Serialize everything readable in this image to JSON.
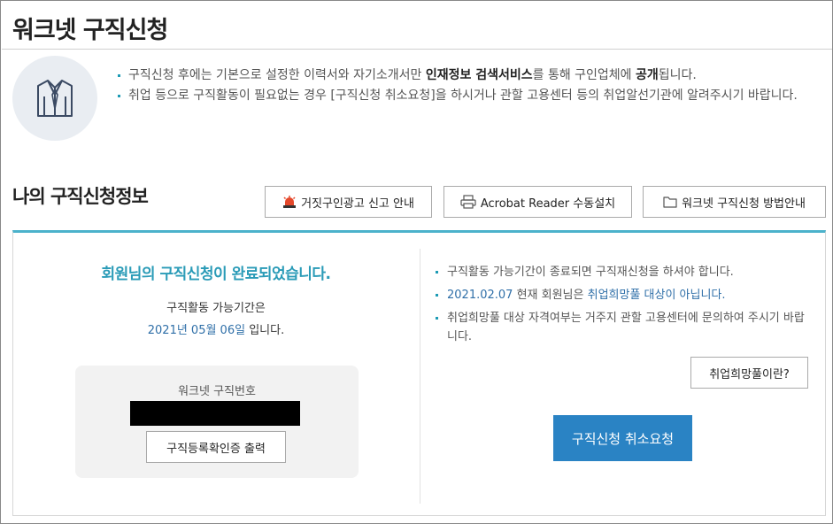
{
  "header": {
    "title": "워크넷 구직신청"
  },
  "intro": {
    "icon": "shirt-icon",
    "line1": {
      "pre": "구직신청 후에는 기본으로 설정한 이력서와 자기소개서만 ",
      "bold1": "인재정보 검색서비스",
      "mid": "를 통해 구인업체에 ",
      "bold2": "공개",
      "post": "됩니다."
    },
    "line2": "취업 등으로 구직활동이 필요없는 경우 [구직신청 취소요청]을 하시거나 관할 고용센터 등의 취업알선기관에 알려주시기 바랍니다."
  },
  "section": {
    "title": "나의 구직신청정보",
    "buttons": {
      "report": {
        "label": "거짓구인광고 신고 안내",
        "icon": "siren-icon"
      },
      "acrobat": {
        "label": "Acrobat Reader 수동설치",
        "icon": "printer-icon"
      },
      "guide": {
        "label": "워크넷 구직신청 방법안내",
        "icon": "folder-icon"
      }
    }
  },
  "status": {
    "complete_message": "회원님의 구직신청이 완료되었습니다.",
    "period_label": "구직활동 가능기간은",
    "period_date": "2021년 05월 06일",
    "period_suffix": " 입니다.",
    "worknet_number_label": "워크넷 구직번호",
    "worknet_number_value": "",
    "cert_button": "구직등록확인증 출력"
  },
  "info": {
    "item1": "구직활동 가능기간이 종료되면 구직재신청을 하셔야 합니다.",
    "item2_date": "2021.02.07",
    "item2_mid": " 현재 회원님은 ",
    "item2_status": "취업희망풀 대상이 아닙니다.",
    "item3": "취업희망풀 대상 자격여부는 거주지 관할 고용센터에 문의하여 주시기 바랍니다.",
    "hope_pool_button": "취업희망풀이란?",
    "cancel_button": "구직신청 취소요청"
  },
  "colors": {
    "accent": "#2a9bb7",
    "primary_button": "#2a83c4",
    "link": "#2f6fa8",
    "panel_border": "#4bb2cb"
  }
}
